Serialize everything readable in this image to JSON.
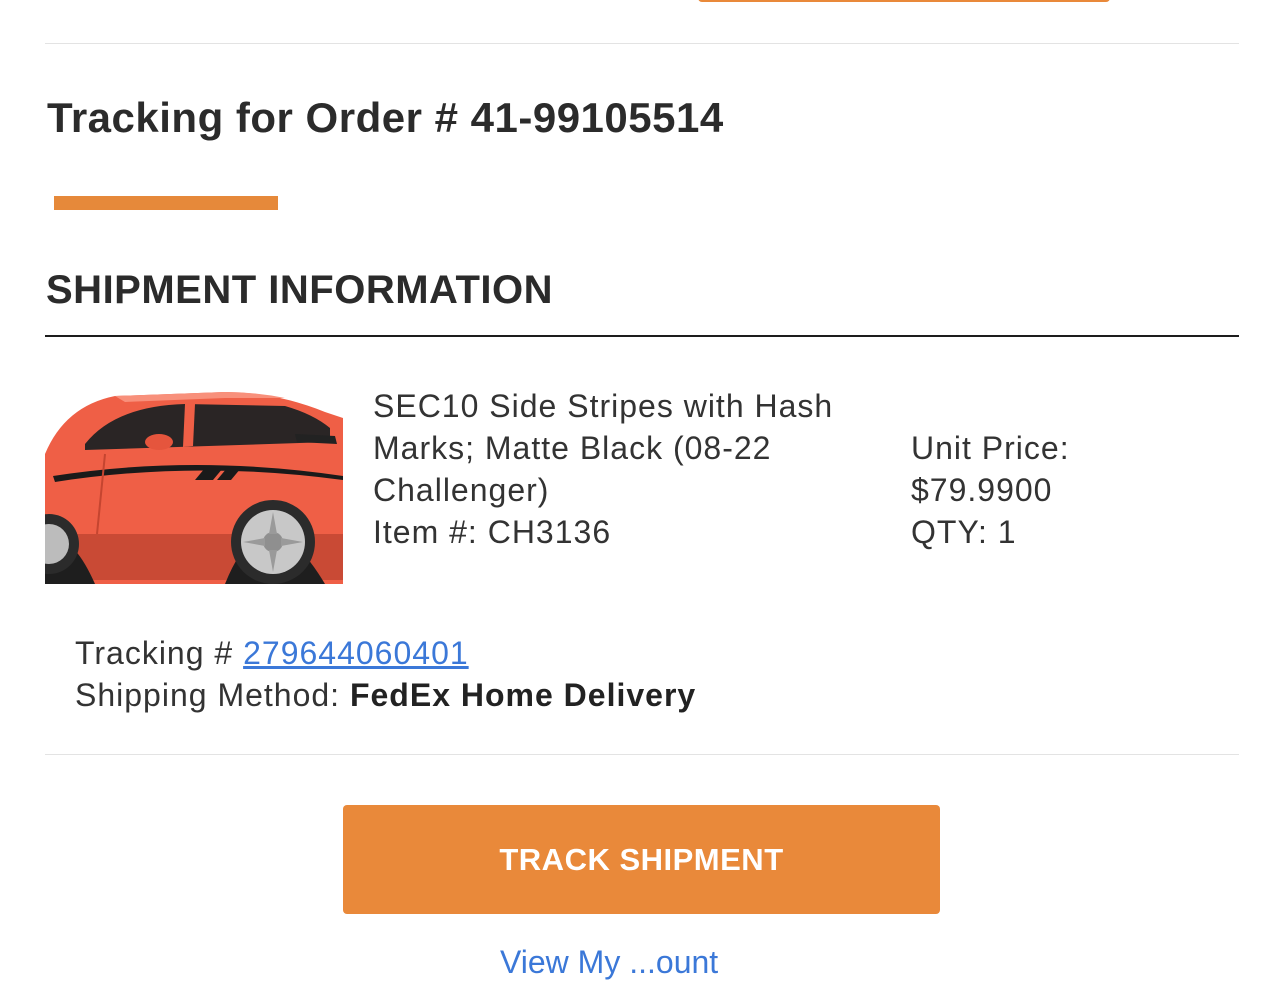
{
  "header": {
    "title": "Tracking for Order # 41-99105514"
  },
  "shipment": {
    "section_title": "SHIPMENT INFORMATION",
    "item": {
      "name": "SEC10 Side Stripes with Hash Marks; Matte Black (08-22 Challenger)",
      "item_number": "Item #: CH3136",
      "unit_price_label": "Unit Price:",
      "unit_price": "$79.9900",
      "qty": "QTY: 1"
    },
    "tracking_label": "Tracking #",
    "tracking_number": "279644060401",
    "shipping_method_label": "Shipping Method:",
    "shipping_method": "FedEx Home Delivery"
  },
  "actions": {
    "track_button": "TRACK SHIPMENT",
    "bottom_link": "View My ...ount"
  },
  "colors": {
    "accent": "#e9893a",
    "link": "#3b78d8",
    "text": "#2b2b2b",
    "car_body": "#f0634a"
  },
  "icons": {
    "product_image": "car-image"
  }
}
